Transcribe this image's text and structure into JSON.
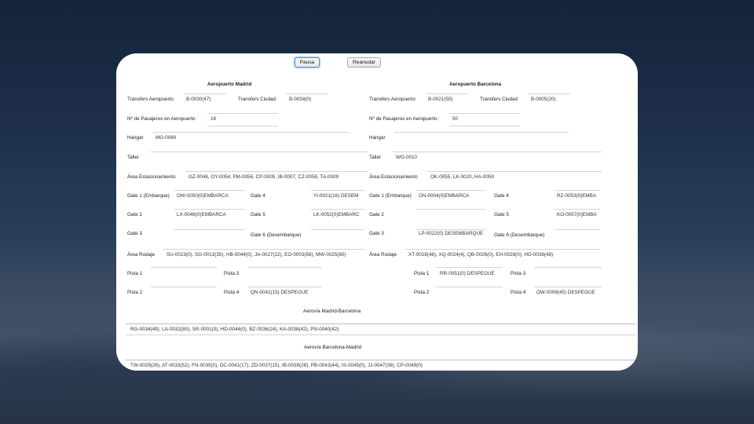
{
  "controls": {
    "pause": "Pausa",
    "resume": "Reanudar"
  },
  "madrid": {
    "title": "Aeropuerto Madrid",
    "transfers_airport_label": "Transfers Aeropuerto",
    "transfers_airport": "B-0030(47)",
    "transfers_city_label": "Transfers Ciudad",
    "transfers_city": "B-0034(0)",
    "passengers_label": "Nº de Pasajeros en Aeropuerto",
    "passengers": "16",
    "hangar_label": "Hangar",
    "hangar": "MO-0060",
    "workshop_label": "Taller",
    "workshop": "",
    "parking_label": "Área Estacionamiento",
    "parking": "GZ-0048, OY-0054, PM-0056, CP-0005, IB-0007, CZ-0058, TA-0009",
    "gate1_label": "Gate 1 (Embarque)",
    "gate1": "OW-0050(0)EMBARCA",
    "gate2_label": "Gate 2",
    "gate2": "LX-0046(0)EMBARCA",
    "gate3_label": "Gate 3",
    "gate3": "",
    "gate4_label": "Gate 4",
    "gate4": "YI-0021(16) DESEM",
    "gate5_label": "Gate 5",
    "gate5": "LK-0052(0)EMBARC",
    "gate6_label": "Gate 6 (Desembarque)",
    "gate6": "",
    "taxi_label": "Área Rodaje",
    "taxi": "SU-0023(0), SG-0013(35), HB-0044(0), JA-0027(22), EO-0003(56), MW-0025(80)",
    "runway1_label": "Pista 1",
    "runway1": "",
    "runway2_label": "Pista 2",
    "runway2": "",
    "runway3_label": "Pista 3",
    "runway3": "",
    "runway4_label": "Pista 4",
    "runway4": "QN-0042(15) DESPEGUE"
  },
  "barcelona": {
    "title": "Aeropuerto Barcelona",
    "transfers_airport_label": "Transfers Aeropuerto",
    "transfers_airport": "B-0021(50)",
    "transfers_city_label": "Transfers Ciudad",
    "transfers_city": "B-0005(20)",
    "passengers_label": "Nº de Pasajeros en Aeropuerto",
    "passengers": "50",
    "hangar_label": "Hangar",
    "hangar": "",
    "workshop_label": "Taller",
    "workshop": "WO-0010",
    "parking_label": "Área Estacionamiento",
    "parking": "OK-0055, LK-0020, HA-0059",
    "gate1_label": "Gate 1 (Embarque)",
    "gate1": "GN-0004(0)EMBARCA",
    "gate2_label": "Gate 2",
    "gate2": "",
    "gate3_label": "Gate 3",
    "gate3": "LP-0022(0) DESEMBARQUE",
    "gate4_label": "Gate 4",
    "gate4": "RZ-0053(0)EMBA",
    "gate5_label": "Gate 5",
    "gate5": "KO-0057(0)EMBA",
    "gate6_label": "Gate 6 (Desembarque)",
    "gate6": "",
    "taxi_label": "Área Rodaje",
    "taxi": "XT-0018(48), XQ-0024(4), QB-0026(0), EH-0028(0), HO-0038(48)",
    "runway1_label": "Pista 1",
    "runway1": "RR-0051(0) DESPEGUE",
    "runway2_label": "Pista 2",
    "runway2": "",
    "runway3_label": "Pista 3",
    "runway3": "",
    "runway4_label": "Pista 4",
    "runway4": "OW-0008(45) DESPEGUE"
  },
  "airways": {
    "mad_bcn_title": "Aerovía Madrid-Barcelona",
    "mad_bcn": "RG-0034(49), LA-0032(80), SR-0001(0), HD-0044(0), BZ-0036(24), KA-0038(42), PN-0040(42)",
    "bcn_mad_title": "Aerovía Barcelona-Madrid",
    "bcn_mad": "TW-0029(26), AT-0033(52), FN-0035(0), DC-0041(17), ZD-0037(15), IB-0039(28), PB-0043(44), IS-0045(0), JJ-0047(39), CP-0049(0)"
  }
}
